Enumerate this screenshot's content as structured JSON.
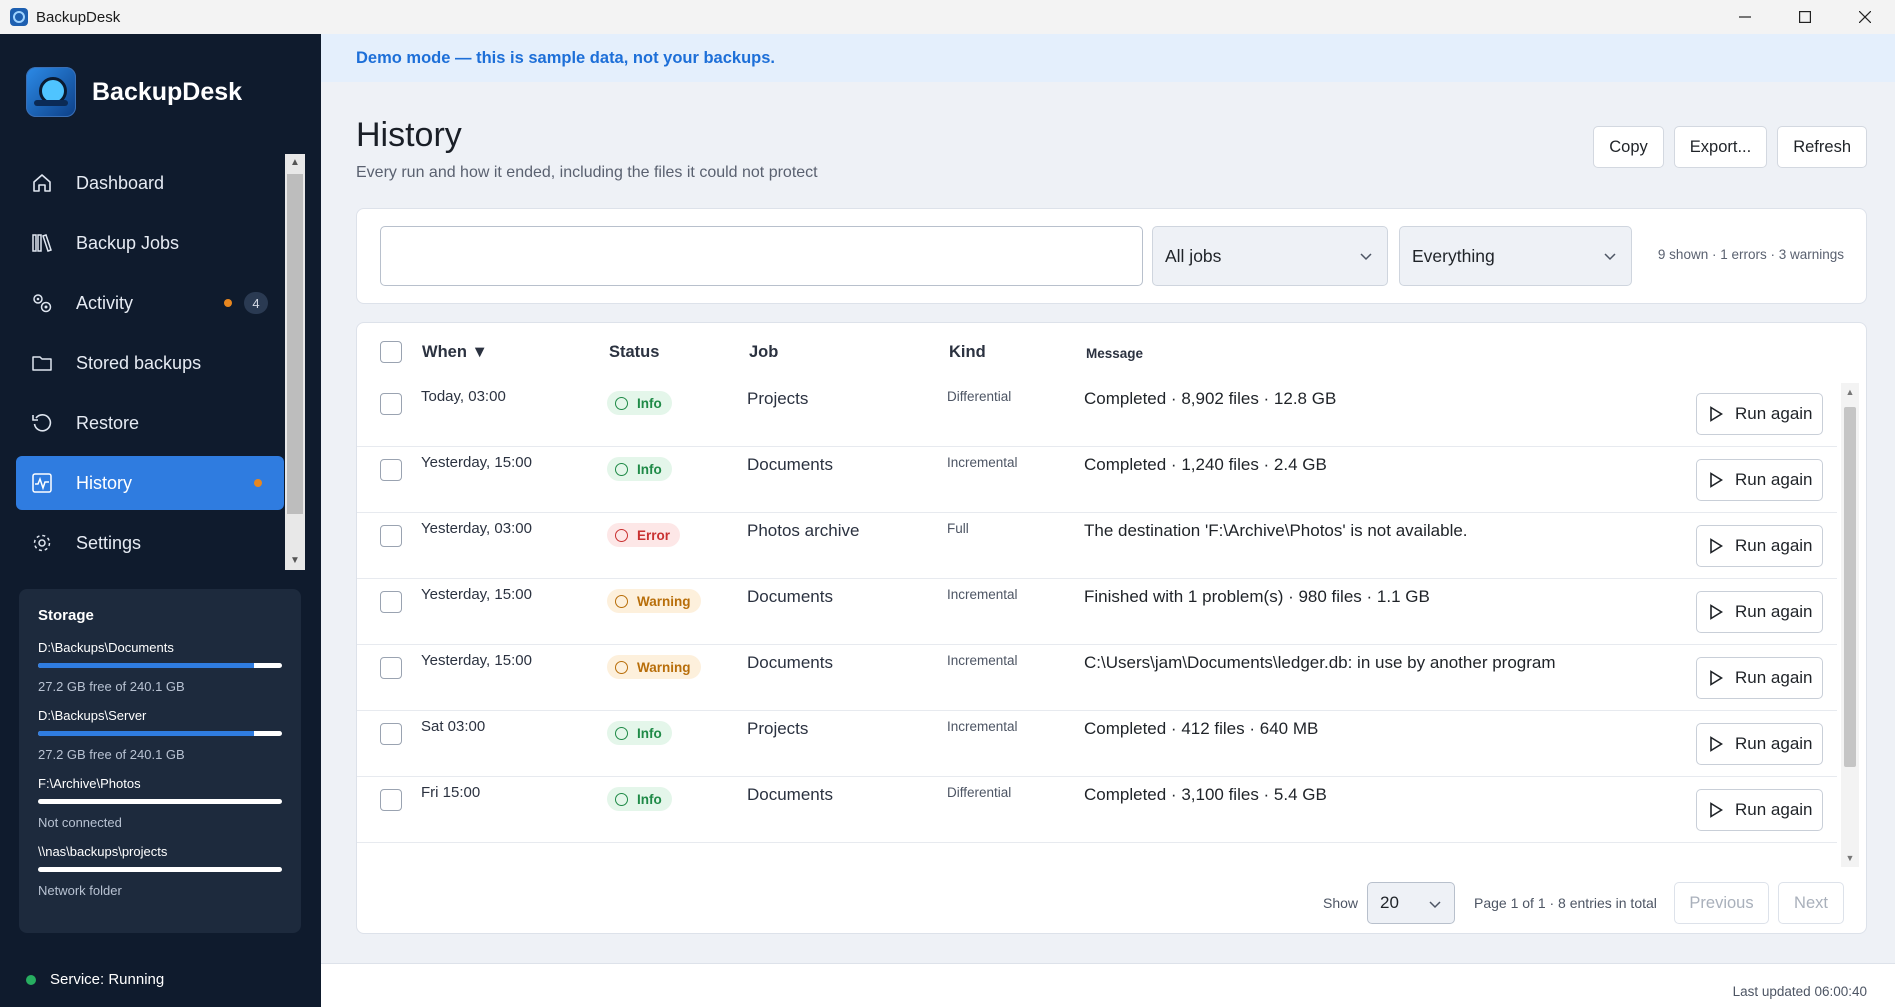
{
  "window": {
    "title": "BackupDesk",
    "controls": [
      "minimize",
      "maximize",
      "close"
    ]
  },
  "sidebar": {
    "brand": "BackupDesk",
    "items": [
      {
        "label": "Dashboard",
        "icon": "home-icon"
      },
      {
        "label": "Backup Jobs",
        "icon": "books-icon"
      },
      {
        "label": "Activity",
        "icon": "activity-gears-icon",
        "dot": true,
        "badge": "4"
      },
      {
        "label": "Stored backups",
        "icon": "folder-icon"
      },
      {
        "label": "Restore",
        "icon": "restore-icon"
      },
      {
        "label": "History",
        "icon": "pulse-icon",
        "active": true,
        "dot": true
      },
      {
        "label": "Settings",
        "icon": "gear-icon"
      }
    ],
    "storage": {
      "title": "Storage",
      "locations": [
        {
          "path": "D:\\Backups\\Documents",
          "info": "27.2 GB free of 240.1 GB",
          "used_fraction": 0.887
        },
        {
          "path": "D:\\Backups\\Server",
          "info": "27.2 GB free of 240.1 GB",
          "used_fraction": 0.887
        },
        {
          "path": "F:\\Archive\\Photos",
          "info": "Not connected",
          "used_fraction": 0
        },
        {
          "path": "\\\\nas\\backups\\projects",
          "info": "Network folder",
          "used_fraction": 0
        }
      ]
    },
    "service_status": "Service: Running"
  },
  "banner": "Demo mode — this is sample data, not your backups.",
  "header": {
    "title": "History",
    "subtitle": "Every run and how it ended, including the files it could not protect",
    "actions": {
      "copy": "Copy",
      "export": "Export...",
      "refresh": "Refresh"
    }
  },
  "filters": {
    "search_value": "",
    "job_select": "All jobs",
    "kind_select": "Everything",
    "summary": "9 shown · 1 errors · 3 warnings"
  },
  "table": {
    "columns": {
      "when": "When",
      "sort_indicator": "▼",
      "status": "Status",
      "job": "Job",
      "kind": "Kind",
      "message": "Message"
    },
    "rows": [
      {
        "when": "Today, 03:00",
        "status": "Info",
        "job": "Projects",
        "kind": "Differential",
        "message": "Completed · 8,902 files · 12.8 GB",
        "action": "Run again"
      },
      {
        "when": "Yesterday, 15:00",
        "status": "Info",
        "job": "Documents",
        "kind": "Incremental",
        "message": "Completed · 1,240 files · 2.4 GB",
        "action": "Run again"
      },
      {
        "when": "Yesterday, 03:00",
        "status": "Error",
        "job": "Photos archive",
        "kind": "Full",
        "message": "The destination 'F:\\Archive\\Photos' is not available.",
        "action": "Run again"
      },
      {
        "when": "Yesterday, 15:00",
        "status": "Warning",
        "job": "Documents",
        "kind": "Incremental",
        "message": "Finished with 1 problem(s) · 980 files · 1.1 GB",
        "action": "Run again"
      },
      {
        "when": "Yesterday, 15:00",
        "status": "Warning",
        "job": "Documents",
        "kind": "Incremental",
        "message": "C:\\Users\\jam\\Documents\\ledger.db: in use by another program",
        "action": "Run again"
      },
      {
        "when": "Sat 03:00",
        "status": "Info",
        "job": "Projects",
        "kind": "Incremental",
        "message": "Completed · 412 files · 640 MB",
        "action": "Run again"
      },
      {
        "when": "Fri 15:00",
        "status": "Info",
        "job": "Documents",
        "kind": "Differential",
        "message": "Completed · 3,100 files · 5.4 GB",
        "action": "Run again"
      }
    ]
  },
  "pagination": {
    "show_label": "Show",
    "page_size": "20",
    "info": "Page 1 of 1 · 8 entries in total",
    "previous": "Previous",
    "next": "Next"
  },
  "footer": {
    "last_updated": "Last updated 06:00:40"
  },
  "colors": {
    "accent": "#2f7ce0",
    "sidebar": "#0f1b2d",
    "info": "#1f8a47",
    "error": "#c93131",
    "warning": "#b86e0a",
    "dot": "#e8871f"
  }
}
